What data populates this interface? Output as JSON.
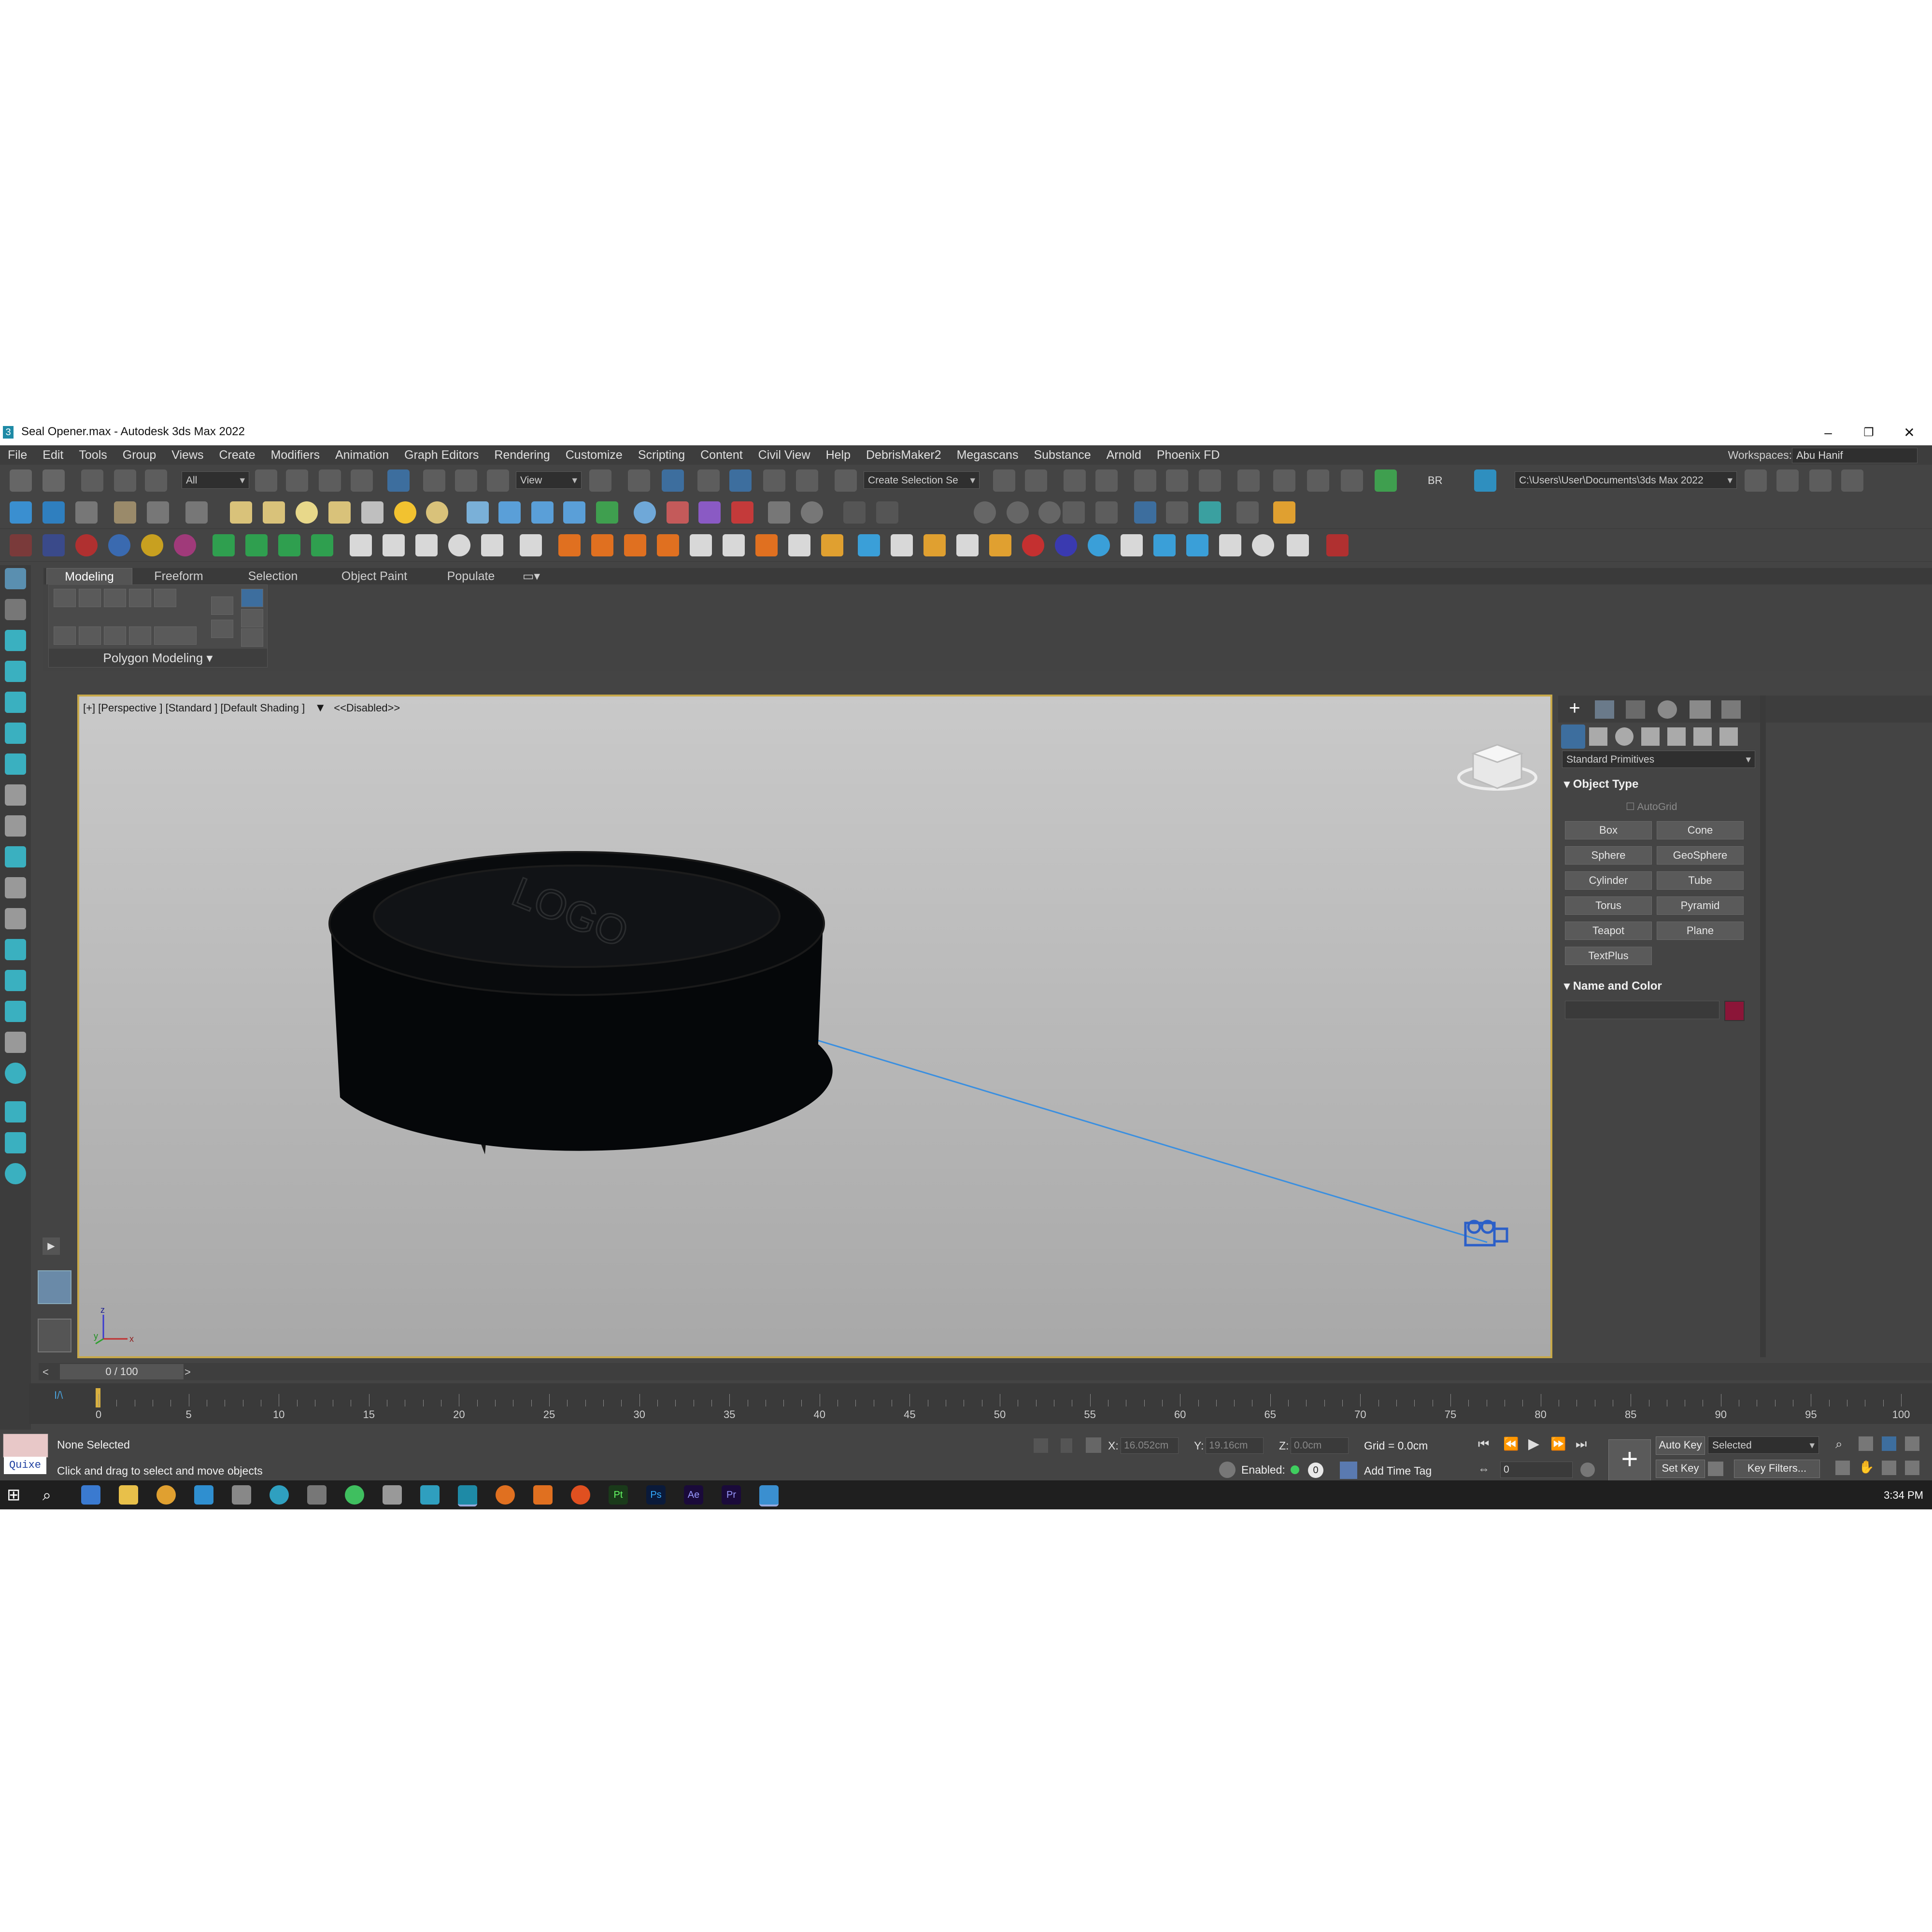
{
  "window": {
    "title": "Seal Opener.max - Autodesk 3ds Max 2022",
    "app_icon": "3"
  },
  "menu": [
    "File",
    "Edit",
    "Tools",
    "Group",
    "Views",
    "Create",
    "Modifiers",
    "Animation",
    "Graph Editors",
    "Rendering",
    "Customize",
    "Scripting",
    "Content",
    "Civil View",
    "Help",
    "DebrisMaker2",
    "Megascans",
    "Substance",
    "Arnold",
    "Phoenix FD"
  ],
  "workspace": {
    "label": "Workspaces:",
    "value": "Abu Hanif"
  },
  "toolbar": {
    "filter": "All",
    "ref_coord": "View",
    "selection_set": "Create Selection Se",
    "br_label": "BR",
    "project_path": "C:\\Users\\User\\Documents\\3ds Max 2022"
  },
  "ribbon": {
    "tabs": [
      "Modeling",
      "Freeform",
      "Selection",
      "Object Paint",
      "Populate"
    ],
    "panel_label": "Polygon Modeling ▾"
  },
  "viewport": {
    "label": "[+] [Perspective ] [Standard ] [Default Shading ]",
    "filter_state": "<<Disabled>>",
    "object_text": "LOGO",
    "axis_z": "z",
    "axis_x": "x",
    "axis_y": "y"
  },
  "command_panel": {
    "category": "Standard Primitives",
    "object_type_header": "Object Type",
    "autogrid": "AutoGrid",
    "buttons": [
      "Box",
      "Cone",
      "Sphere",
      "GeoSphere",
      "Cylinder",
      "Tube",
      "Torus",
      "Pyramid",
      "Teapot",
      "Plane",
      "TextPlus"
    ],
    "name_color_header": "Name and Color",
    "object_color": "#8b1538"
  },
  "timeline": {
    "slider_text": "0 / 100",
    "ticks": [
      "0",
      "5",
      "10",
      "15",
      "20",
      "25",
      "30",
      "35",
      "40",
      "45",
      "50",
      "55",
      "60",
      "65",
      "70",
      "75",
      "80",
      "85",
      "90",
      "95",
      "100"
    ]
  },
  "status": {
    "selection": "None Selected",
    "prompt": "Click and drag to select and move objects",
    "maxscript": "Quixe",
    "x_label": "X:",
    "x_value": "16.052cm",
    "y_label": "Y:",
    "y_value": "19.16cm",
    "z_label": "Z:",
    "z_value": "0.0cm",
    "grid": "Grid = 0.0cm",
    "enabled_label": "Enabled:",
    "enabled_count": "0",
    "add_time_tag": "Add Time Tag",
    "auto_key": "Auto Key",
    "key_mode": "Selected",
    "set_key": "Set Key",
    "key_filters": "Key Filters...",
    "frame": "0"
  },
  "taskbar": {
    "clock": "3:34 PM"
  }
}
